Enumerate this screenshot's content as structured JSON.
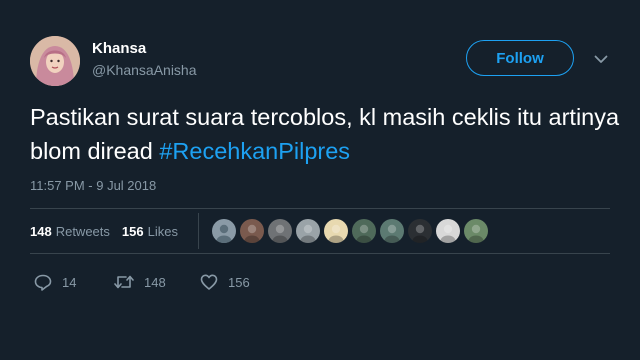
{
  "author": {
    "display_name": "Khansa",
    "handle": "@KhansaAnisha",
    "avatar_icon": "profile-photo"
  },
  "follow_button": {
    "label": "Follow",
    "accent": "#1da1f2"
  },
  "tweet": {
    "text_plain": "Pastikan surat suara tercoblos, kl masih ceklis itu artinya blom diread ",
    "hashtag": "#RecehkanPilpres",
    "timestamp": "11:57 PM - 9 Jul 2018"
  },
  "stats": {
    "retweets_count": "148",
    "retweets_label": "Retweets",
    "likes_count": "156",
    "likes_label": "Likes"
  },
  "liked_by_avatars": [
    {
      "icon": "default-avatar",
      "color": "#8a9aa6"
    },
    {
      "icon": "avatar-photo",
      "color": "#7a5a4e"
    },
    {
      "icon": "avatar-photo",
      "color": "#6f7275"
    },
    {
      "icon": "avatar-photo",
      "color": "#9aa3a8"
    },
    {
      "icon": "avatar-photo",
      "color": "#e8d9b0"
    },
    {
      "icon": "avatar-photo",
      "color": "#4f6a5a"
    },
    {
      "icon": "avatar-photo",
      "color": "#5c7a72"
    },
    {
      "icon": "avatar-photo",
      "color": "#2b2f33"
    },
    {
      "icon": "avatar-photo",
      "color": "#d8d8d8"
    },
    {
      "icon": "avatar-photo",
      "color": "#6b8a68"
    }
  ],
  "actions": {
    "reply_count": "14",
    "retweet_count": "148",
    "like_count": "156"
  },
  "colors": {
    "background": "#15202b",
    "text": "#ffffff",
    "muted": "#8899a6",
    "link": "#1da1f2",
    "divider": "#38444d"
  }
}
